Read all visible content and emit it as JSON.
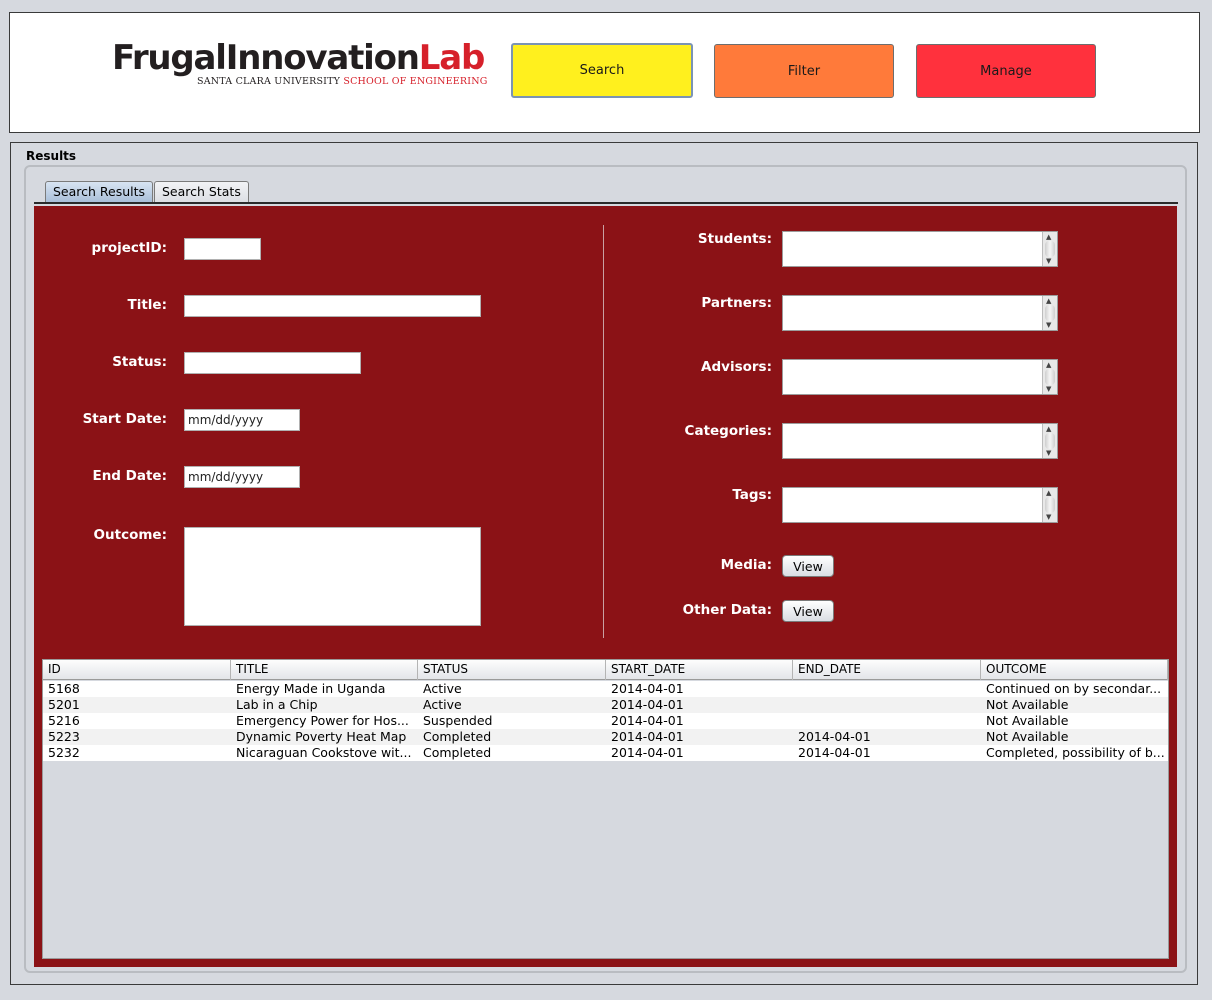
{
  "header": {
    "logo": {
      "frugal": "FrugalInnovation",
      "lab": "Lab",
      "university": "SANTA CLARA UNIVERSITY",
      "school": "SCHOOL OF ENGINEERING"
    },
    "buttons": {
      "search": "Search",
      "filter": "Filter",
      "manage": "Manage"
    }
  },
  "results": {
    "title": "Results",
    "tabs": [
      "Search Results",
      "Search Stats"
    ],
    "active_tab": "Search Results"
  },
  "form": {
    "left": {
      "project_id_label": "projectID:",
      "title_label": "Title:",
      "status_label": "Status:",
      "start_date_label": "Start Date:",
      "start_date_value": "mm/dd/yyyy",
      "end_date_label": "End Date:",
      "end_date_value": "mm/dd/yyyy",
      "outcome_label": "Outcome:"
    },
    "right": {
      "students_label": "Students:",
      "partners_label": "Partners:",
      "advisors_label": "Advisors:",
      "categories_label": "Categories:",
      "tags_label": "Tags:",
      "media_label": "Media:",
      "other_data_label": "Other Data:",
      "view_label": "View"
    }
  },
  "table": {
    "columns": [
      "ID",
      "TITLE",
      "STATUS",
      "START_DATE",
      "END_DATE",
      "OUTCOME"
    ],
    "rows": [
      [
        "5168",
        "Energy Made in Uganda",
        "Active",
        "2014-04-01",
        "",
        "Continued on by secondar..."
      ],
      [
        "5201",
        "Lab in a Chip",
        "Active",
        "2014-04-01",
        "",
        "Not Available"
      ],
      [
        "5216",
        "Emergency Power for Hos...",
        "Suspended",
        "2014-04-01",
        "",
        "Not Available"
      ],
      [
        "5223",
        "Dynamic Poverty Heat Map",
        "Completed",
        "2014-04-01",
        "2014-04-01",
        "Not Available"
      ],
      [
        "5232",
        "Nicaraguan Cookstove wit...",
        "Completed",
        "2014-04-01",
        "2014-04-01",
        "Completed, possibility of b..."
      ]
    ]
  },
  "colors": {
    "search_button": "#fff01e",
    "filter_button": "#ff7a3a",
    "manage_button": "#ff313d",
    "form_background": "#8b1216",
    "brand_red": "#d6202a"
  }
}
